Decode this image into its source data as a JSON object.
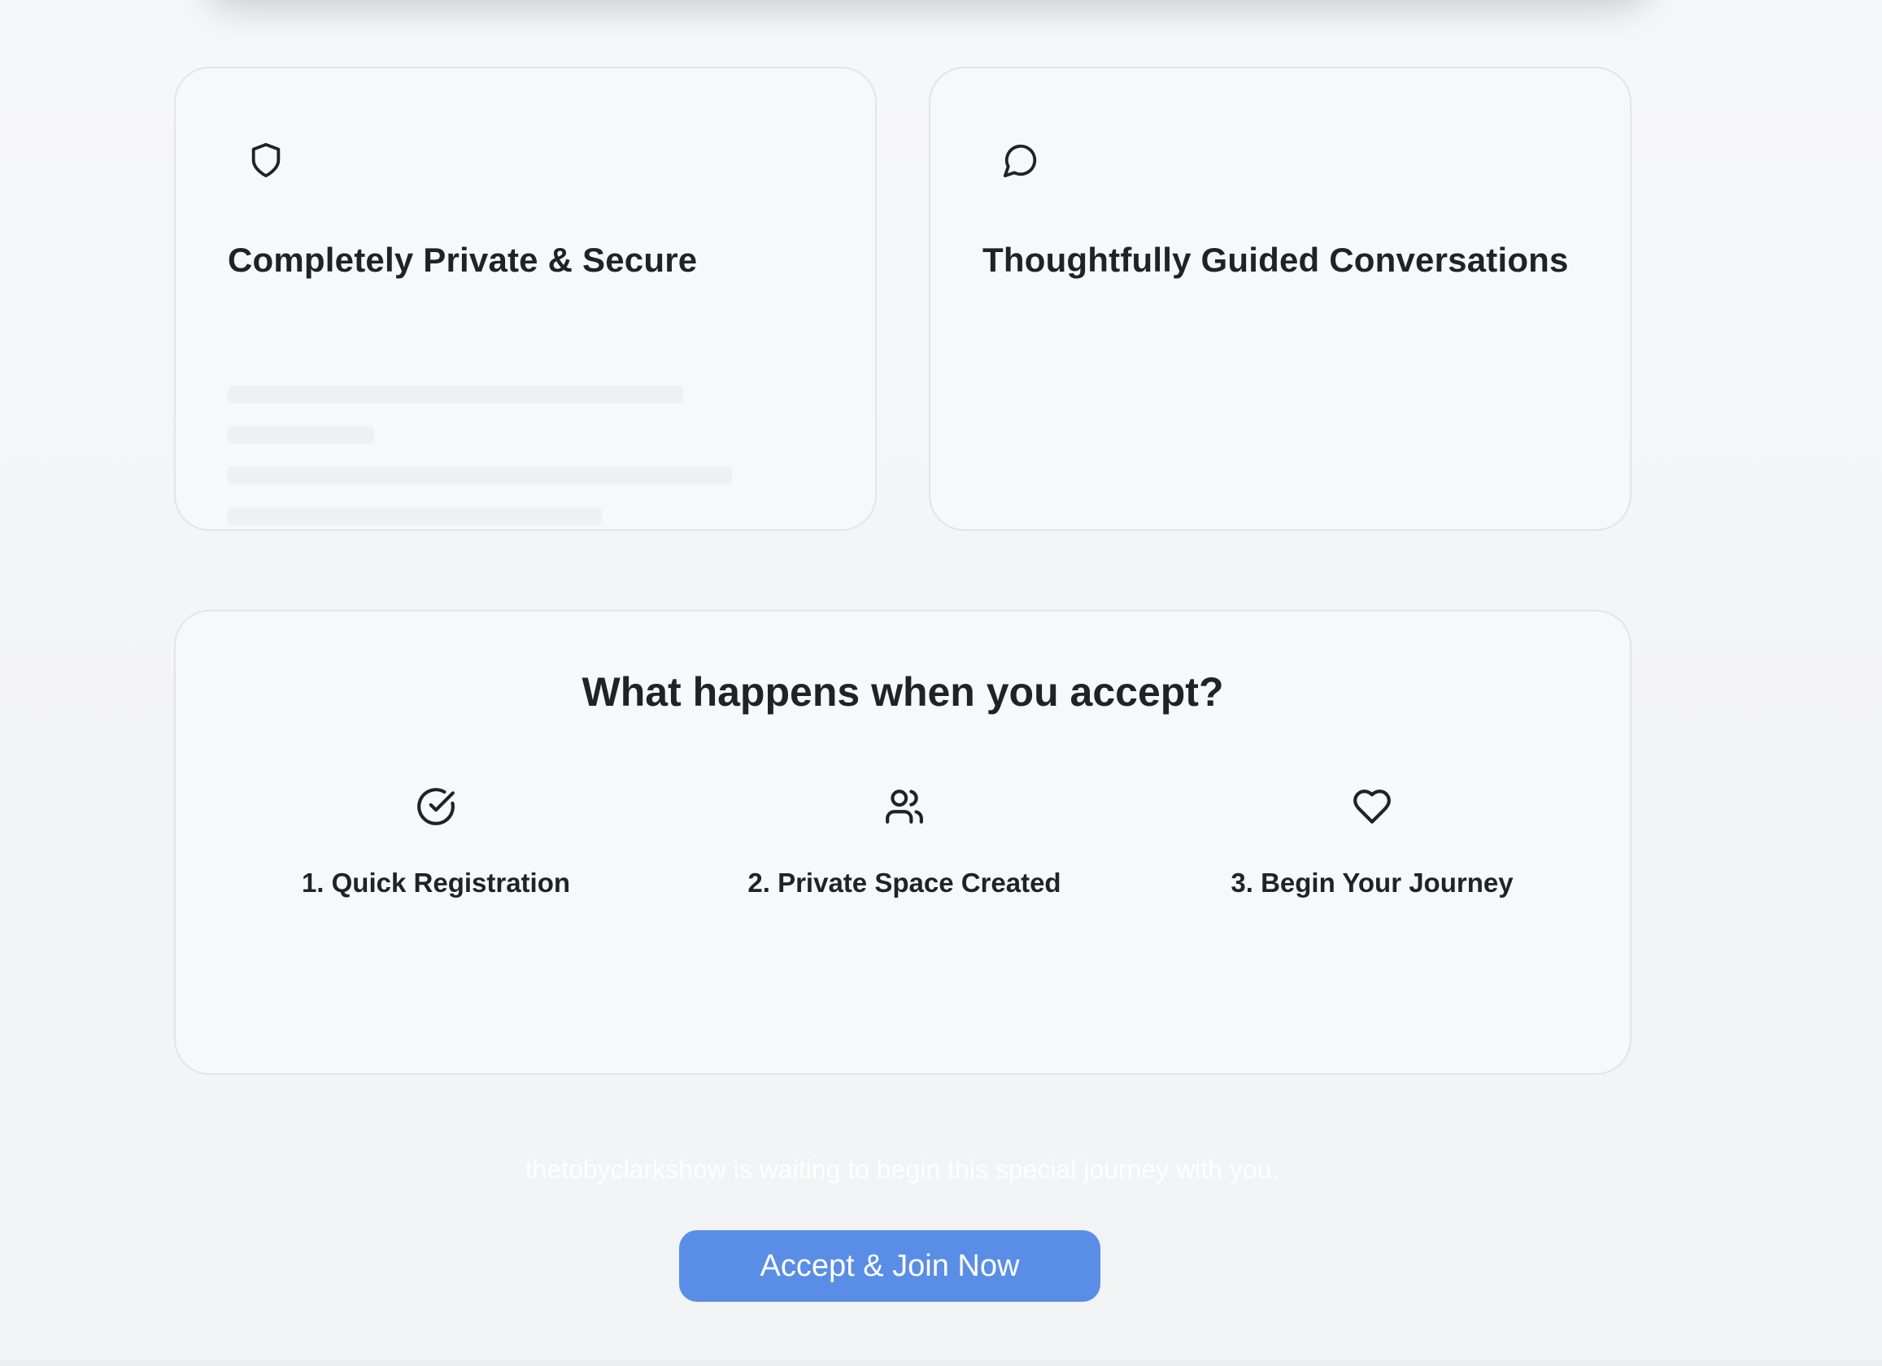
{
  "features": [
    {
      "icon": "shield-icon",
      "title": "Completely Private & Secure"
    },
    {
      "icon": "message-circle-icon",
      "title": "Thoughtfully Guided Conversations"
    }
  ],
  "steps_section": {
    "title": "What happens when you accept?",
    "steps": [
      {
        "icon": "check-circle-icon",
        "label": "1. Quick Registration"
      },
      {
        "icon": "users-icon",
        "label": "2. Private Space Created"
      },
      {
        "icon": "heart-icon",
        "label": "3. Begin Your Journey"
      }
    ]
  },
  "invite": {
    "waiting_text": "thetobyclarkshow is waiting to begin this special journey with you.",
    "accept_label": "Accept & Join Now"
  },
  "colors": {
    "accent": "#5a8de6",
    "text": "#1f2328",
    "card_border": "#e2e4e8",
    "background": "#f3f4f6"
  }
}
